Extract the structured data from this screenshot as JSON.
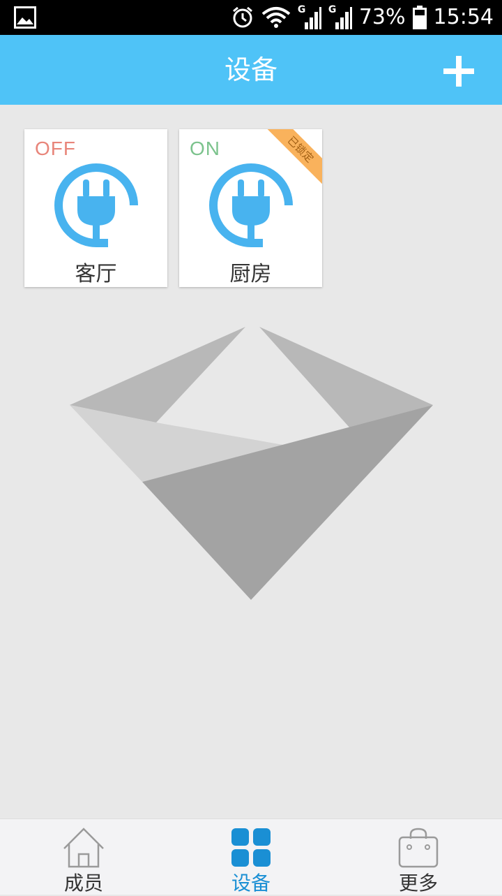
{
  "status_bar": {
    "battery": "73%",
    "time": "15:54",
    "network_label_1": "G",
    "network_label_2": "G"
  },
  "header": {
    "title": "设备",
    "add_icon": "plus-icon"
  },
  "devices": [
    {
      "name": "客厅",
      "state": "OFF",
      "state_color": "#e8857a",
      "icon": "plug-icon",
      "locked": false
    },
    {
      "name": "厨房",
      "state": "ON",
      "state_color": "#7cc38d",
      "icon": "plug-icon",
      "locked": true,
      "lock_label": "已锁定"
    }
  ],
  "colors": {
    "accent": "#4fc3f7",
    "active_nav": "#1a8fd4",
    "lock_ribbon": "#f9b25c"
  },
  "bottom_nav": {
    "items": [
      {
        "label": "成员",
        "icon": "home-icon",
        "active": false
      },
      {
        "label": "设备",
        "icon": "grid-icon",
        "active": true
      },
      {
        "label": "更多",
        "icon": "bag-icon",
        "active": false
      }
    ]
  }
}
